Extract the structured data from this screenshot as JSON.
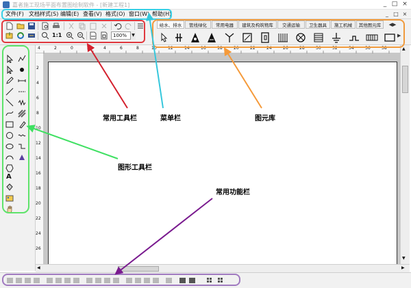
{
  "window": {
    "title": "嘉者施工现场平面布置图绘制软件 - [新建工程1]",
    "minimize": "_",
    "maximize": "□",
    "close": "×"
  },
  "menus": [
    "文件(F)",
    "文档样式(S)",
    "编辑(E)",
    "查看(V)",
    "格式(O)",
    "窗口(W)",
    "帮助(H)"
  ],
  "mdi_controls": [
    "_",
    "□",
    "×"
  ],
  "toolbar": {
    "zoom_ratio": "1:1",
    "zoom_value": "100%"
  },
  "library": {
    "tabs": [
      "给水、排水",
      "管线绿化",
      "常用电器",
      "建筑及构筑物库",
      "交通运输",
      "卫生器具",
      "施工机械",
      "其他图元库"
    ],
    "symbols": [
      "pointer",
      "double-pole",
      "tower-crane",
      "tower-crane-2",
      "antenna",
      "transformer-box",
      "door",
      "wall-lines",
      "pump-circle",
      "layered-lines",
      "ground",
      "pulley",
      "grid-track",
      "rectangle-box"
    ]
  },
  "ruler": {
    "top_labels": [
      "4",
      "2",
      "0",
      "2",
      "4",
      "6",
      "8",
      "10",
      "12",
      "14",
      "16",
      "18",
      "20",
      "22",
      "24",
      "26",
      "28",
      "30",
      "32",
      "34",
      "36",
      "38"
    ],
    "left_labels": [
      "2",
      "4",
      "6",
      "8",
      "10",
      "12",
      "14",
      "16",
      "18",
      "20",
      "22",
      "24",
      "26",
      "28"
    ]
  },
  "callouts": {
    "toolbar": "常用工具栏",
    "menubar": "菜单栏",
    "library": "图元库",
    "shapes": "图形工具栏",
    "functions": "常用功能栏"
  },
  "colors": {
    "toolbar_highlight": "#e0383e",
    "menubar_highlight": "#38d0e6",
    "library_highlight": "#f09a3c",
    "shapes_highlight": "#5ee36a",
    "functions_highlight": "#a07ac0",
    "toolbar_arrow": "#d4212e",
    "menubar_arrow": "#35c7dc",
    "library_arrow": "#f59a3a",
    "shapes_arrow": "#3fe062",
    "functions_arrow": "#7a1b8f"
  }
}
